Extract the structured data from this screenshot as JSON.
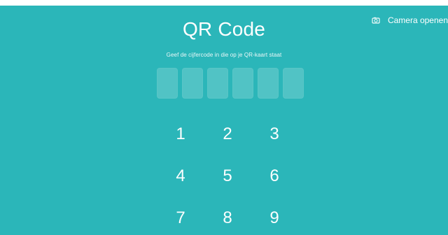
{
  "colors": {
    "background": "#2bb6b9",
    "text": "#ffffff",
    "code_box": "rgba(255,255,255,0.18)"
  },
  "header": {
    "camera_button_label": "Camera openen",
    "camera_icon": "camera-icon"
  },
  "main": {
    "title": "QR Code",
    "subtitle": "Geef de cijfercode in die op je QR-kaart staat",
    "code_boxes_count": 6
  },
  "keypad": {
    "keys": [
      "1",
      "2",
      "3",
      "4",
      "5",
      "6",
      "7",
      "8",
      "9"
    ]
  }
}
